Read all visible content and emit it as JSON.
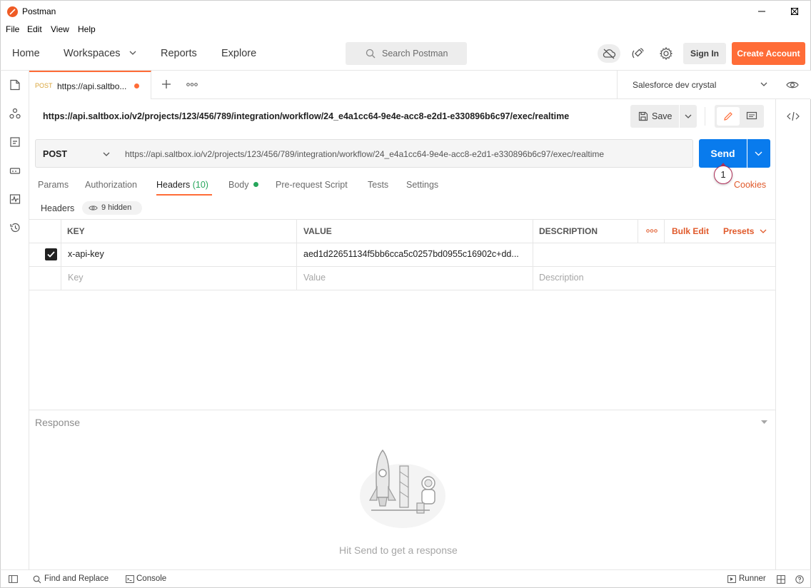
{
  "window": {
    "title": "Postman"
  },
  "menu": [
    "File",
    "Edit",
    "View",
    "Help"
  ],
  "header": {
    "nav": [
      "Home",
      "Workspaces",
      "Reports",
      "Explore"
    ],
    "search_placeholder": "Search Postman",
    "sign_in": "Sign In",
    "create_account": "Create Account"
  },
  "tab": {
    "method": "POST",
    "url": "https://api.saltbo..."
  },
  "environment": "Salesforce dev crystal",
  "request": {
    "title": "https://api.saltbox.io/v2/projects/123/456/789/integration/workflow/24_e4a1cc64-9e4e-acc8-e2d1-e330896b6c97/exec/realtime",
    "save_label": "Save",
    "method": "POST",
    "url": "https://api.saltbox.io/v2/projects/123/456/789/integration/workflow/24_e4a1cc64-9e4e-acc8-e2d1-e330896b6c97/exec/realtime",
    "send_label": "Send",
    "callout": "1"
  },
  "request_tabs": {
    "params": "Params",
    "authorization": "Authorization",
    "headers": "Headers",
    "headers_count": "(10)",
    "body": "Body",
    "prerequest": "Pre-request Script",
    "tests": "Tests",
    "settings": "Settings",
    "cookies": "Cookies"
  },
  "headers_section": {
    "label": "Headers",
    "hidden": "9 hidden"
  },
  "table": {
    "columns": [
      "KEY",
      "VALUE",
      "DESCRIPTION"
    ],
    "bulk_edit": "Bulk Edit",
    "presets": "Presets",
    "rows": [
      {
        "key": "x-api-key",
        "value": "aed1d22651134f5bb6cca5c0257bd0955c16902c+dd...",
        "description": "",
        "checked": true
      }
    ],
    "placeholders": {
      "key": "Key",
      "value": "Value",
      "description": "Description"
    }
  },
  "response": {
    "title": "Response",
    "hint": "Hit Send to get a response"
  },
  "statusbar": {
    "find_replace": "Find and Replace",
    "console": "Console",
    "runner": "Runner"
  },
  "colors": {
    "accent": "#ff6c37",
    "send": "#097bed",
    "link": "#e0592a",
    "success": "#26a65b"
  }
}
